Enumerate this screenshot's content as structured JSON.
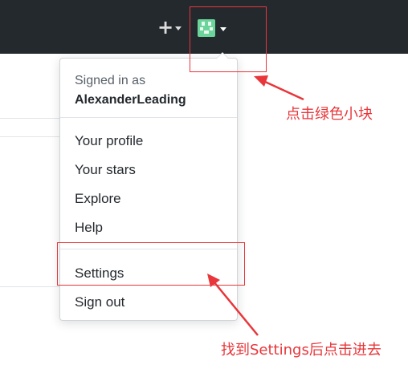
{
  "header": {
    "new_icon": "plus-icon",
    "avatar_icon": "identicon-avatar",
    "caret_icon": "caret-down-icon"
  },
  "dropdown": {
    "signed_in_label": "Signed in as",
    "username": "AlexanderLeading",
    "items": [
      {
        "label": "Your profile"
      },
      {
        "label": "Your stars"
      },
      {
        "label": "Explore"
      },
      {
        "label": "Help"
      },
      {
        "label": "Settings"
      },
      {
        "label": "Sign out"
      }
    ]
  },
  "annotations": {
    "avatar_hint": "点击绿色小块",
    "settings_hint": "找到Settings后点击进去",
    "color": "#e8363a"
  },
  "colors": {
    "topbar": "#24292e",
    "avatar_green": "#6bd49a"
  }
}
